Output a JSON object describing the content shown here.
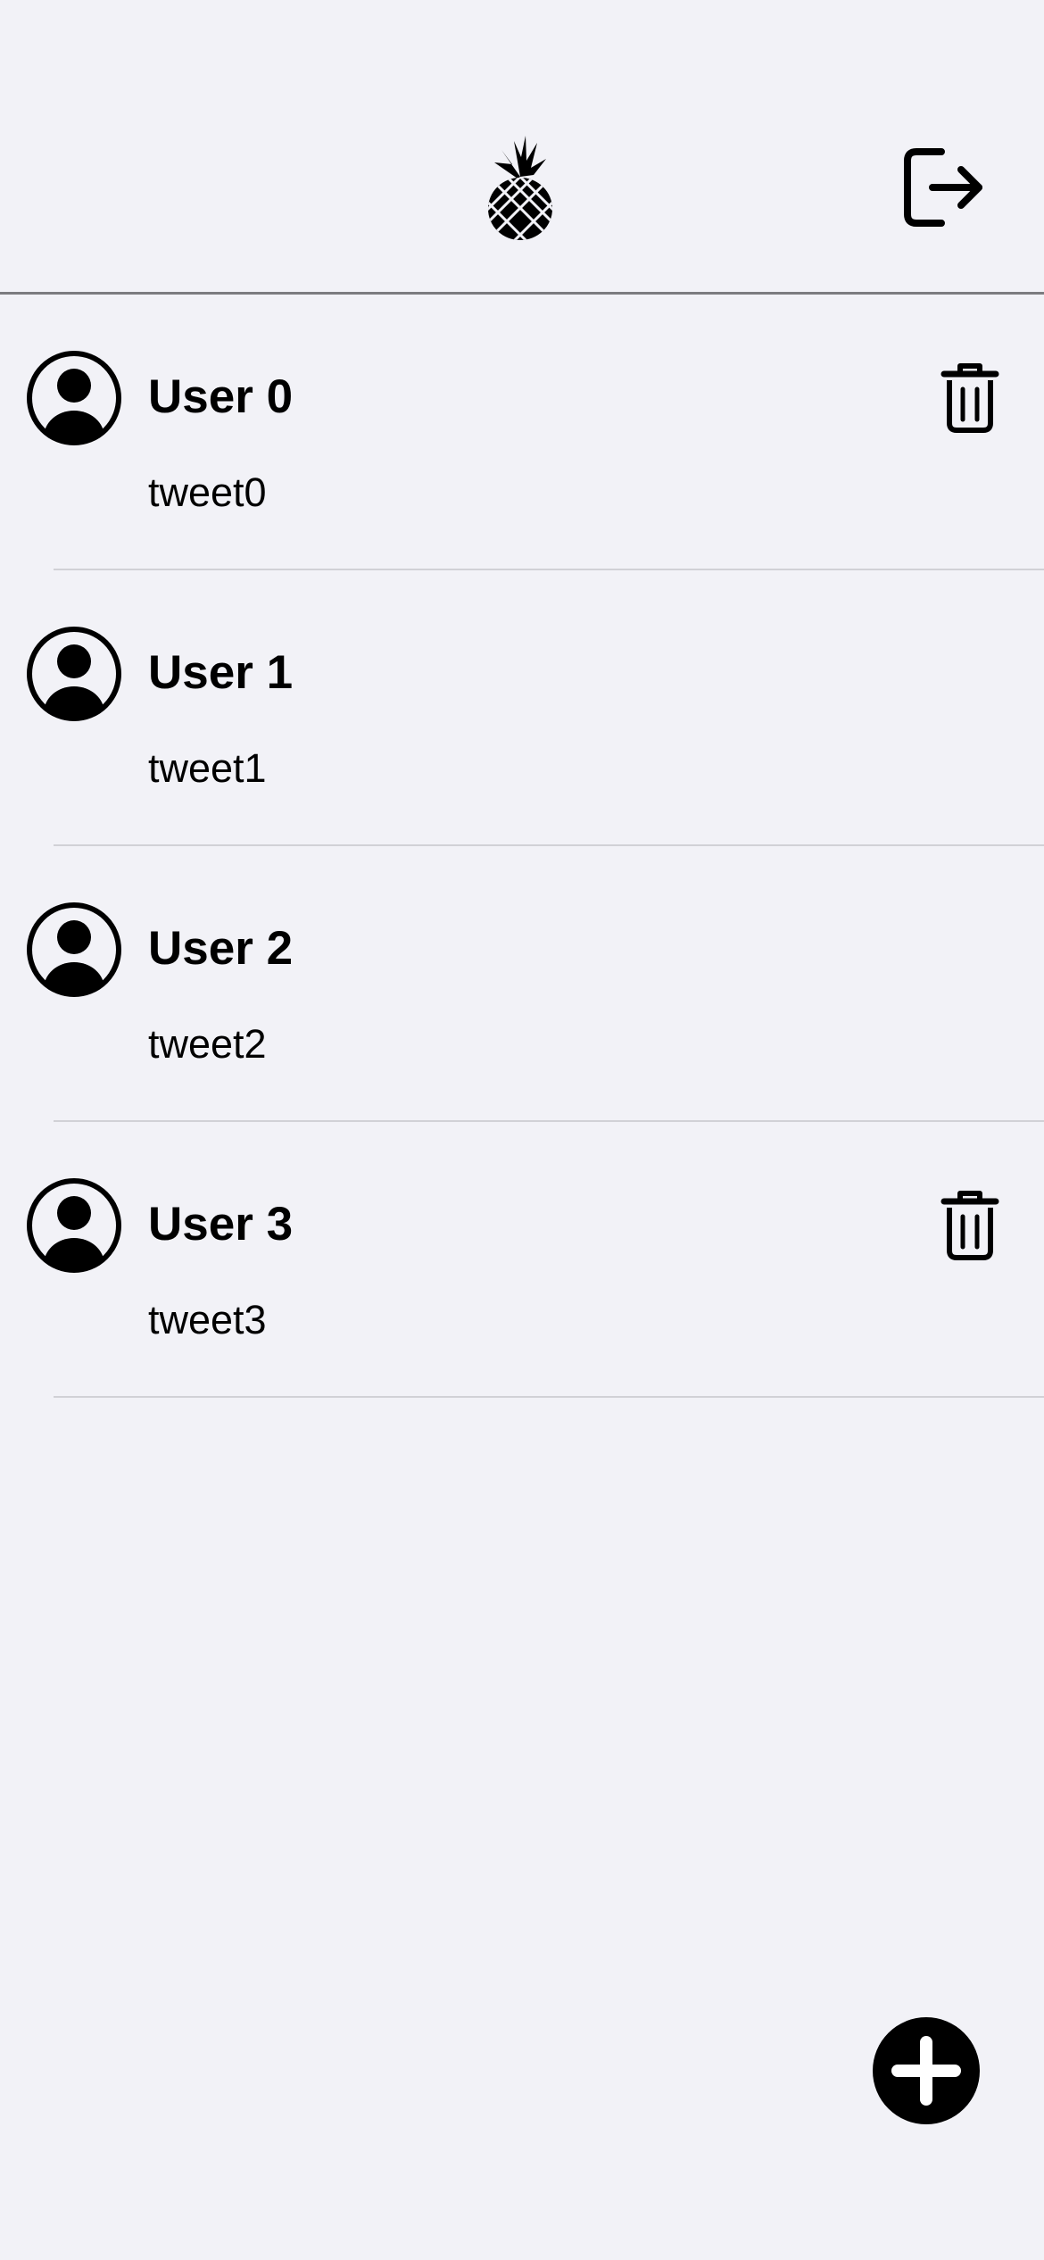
{
  "header": {
    "logo_icon": "pineapple-icon",
    "logout_icon": "logout-icon"
  },
  "feed": {
    "items": [
      {
        "username": "User 0",
        "tweet": "tweet0",
        "deletable": true
      },
      {
        "username": "User 1",
        "tweet": "tweet1",
        "deletable": false
      },
      {
        "username": "User 2",
        "tweet": "tweet2",
        "deletable": false
      },
      {
        "username": "User 3",
        "tweet": "tweet3",
        "deletable": true
      }
    ]
  },
  "fab": {
    "icon": "plus-icon"
  },
  "colors": {
    "background": "#f2f2f7",
    "separator": "#d1d1d6",
    "header_border": "#7c7c80",
    "foreground": "#000000"
  }
}
